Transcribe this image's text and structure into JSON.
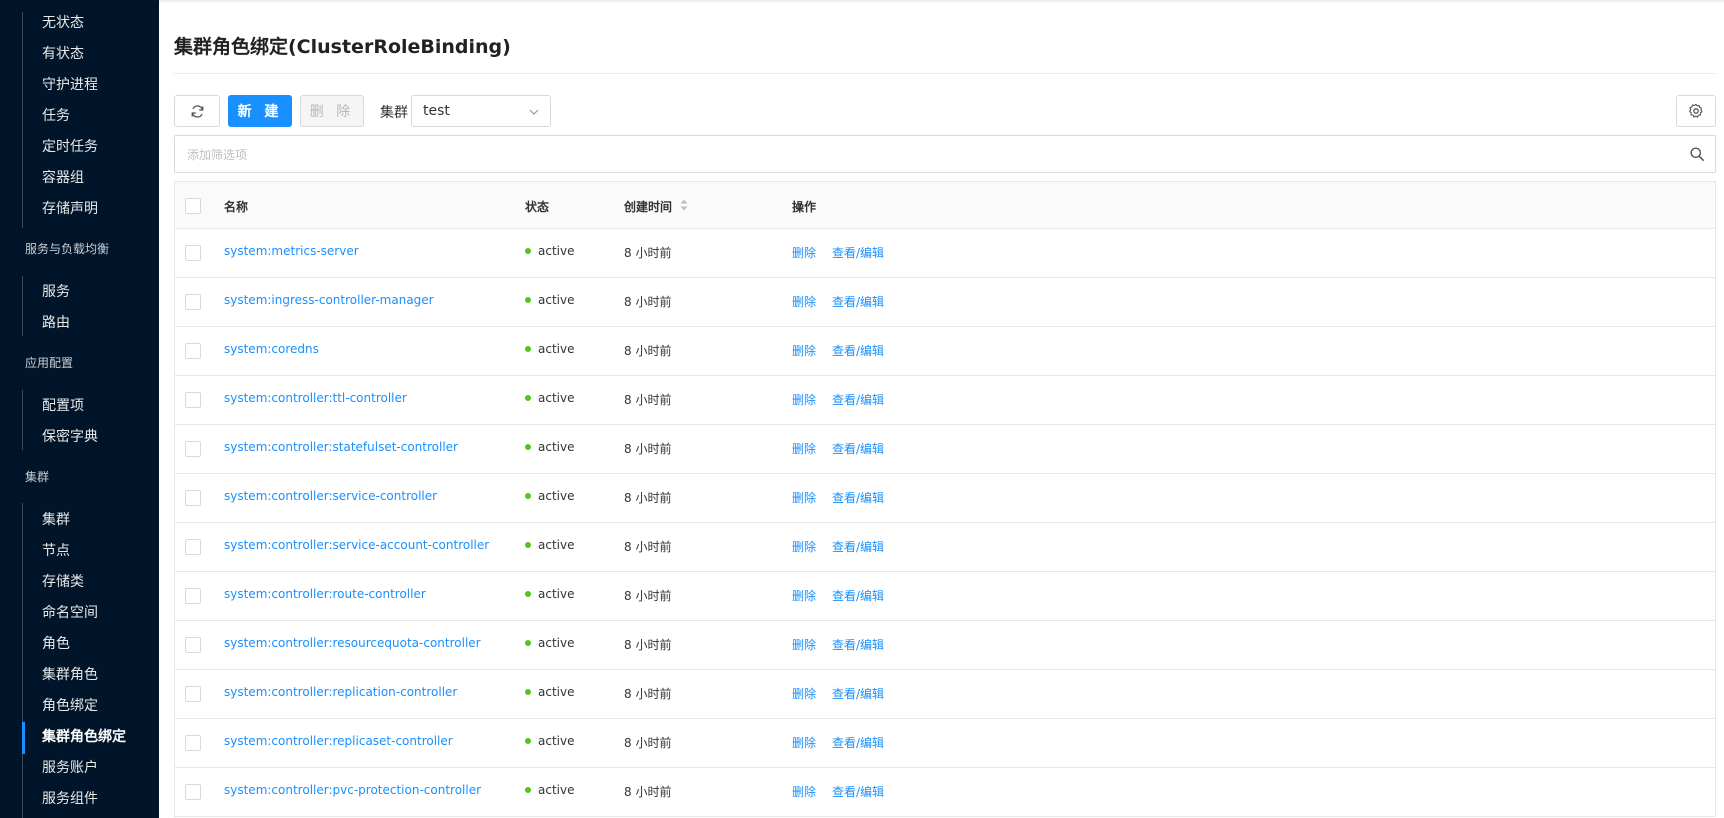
{
  "sidebar": {
    "items_top": [
      "无状态",
      "有状态",
      "守护进程",
      "任务",
      "定时任务",
      "容器组",
      "存储声明"
    ],
    "group_service": "服务与负载均衡",
    "items_service": [
      "服务",
      "路由"
    ],
    "group_config": "应用配置",
    "items_config": [
      "配置项",
      "保密字典"
    ],
    "group_cluster": "集群",
    "items_cluster": [
      "集群",
      "节点",
      "存储类",
      "命名空间",
      "角色",
      "集群角色",
      "角色绑定",
      "集群角色绑定",
      "服务账户",
      "服务组件"
    ],
    "active_item": "集群角色绑定",
    "accent_color": "#1890ff",
    "background_color": "#001529"
  },
  "page": {
    "title": "集群角色绑定(ClusterRoleBinding)"
  },
  "toolbar": {
    "refresh_icon": "refresh-icon",
    "new_label": "新 建",
    "delete_label": "删 除",
    "cluster_label": "集群",
    "cluster_value": "test",
    "settings_icon": "gear-icon"
  },
  "filter": {
    "placeholder": "添加筛选项",
    "search_icon": "search-icon"
  },
  "table": {
    "columns": {
      "name": "名称",
      "status": "状态",
      "created": "创建时间",
      "actions": "操作"
    },
    "rows": [
      {
        "name": "system:metrics-server",
        "status": "active",
        "created": "8 小时前",
        "delete": "删除",
        "edit": "查看/编辑"
      },
      {
        "name": "system:ingress-controller-manager",
        "status": "active",
        "created": "8 小时前",
        "delete": "删除",
        "edit": "查看/编辑"
      },
      {
        "name": "system:coredns",
        "status": "active",
        "created": "8 小时前",
        "delete": "删除",
        "edit": "查看/编辑"
      },
      {
        "name": "system:controller:ttl-controller",
        "status": "active",
        "created": "8 小时前",
        "delete": "删除",
        "edit": "查看/编辑"
      },
      {
        "name": "system:controller:statefulset-controller",
        "status": "active",
        "created": "8 小时前",
        "delete": "删除",
        "edit": "查看/编辑"
      },
      {
        "name": "system:controller:service-controller",
        "status": "active",
        "created": "8 小时前",
        "delete": "删除",
        "edit": "查看/编辑"
      },
      {
        "name": "system:controller:service-account-controller",
        "status": "active",
        "created": "8 小时前",
        "delete": "删除",
        "edit": "查看/编辑"
      },
      {
        "name": "system:controller:route-controller",
        "status": "active",
        "created": "8 小时前",
        "delete": "删除",
        "edit": "查看/编辑"
      },
      {
        "name": "system:controller:resourcequota-controller",
        "status": "active",
        "created": "8 小时前",
        "delete": "删除",
        "edit": "查看/编辑"
      },
      {
        "name": "system:controller:replication-controller",
        "status": "active",
        "created": "8 小时前",
        "delete": "删除",
        "edit": "查看/编辑"
      },
      {
        "name": "system:controller:replicaset-controller",
        "status": "active",
        "created": "8 小时前",
        "delete": "删除",
        "edit": "查看/编辑"
      },
      {
        "name": "system:controller:pvc-protection-controller",
        "status": "active",
        "created": "8 小时前",
        "delete": "删除",
        "edit": "查看/编辑"
      }
    ]
  }
}
